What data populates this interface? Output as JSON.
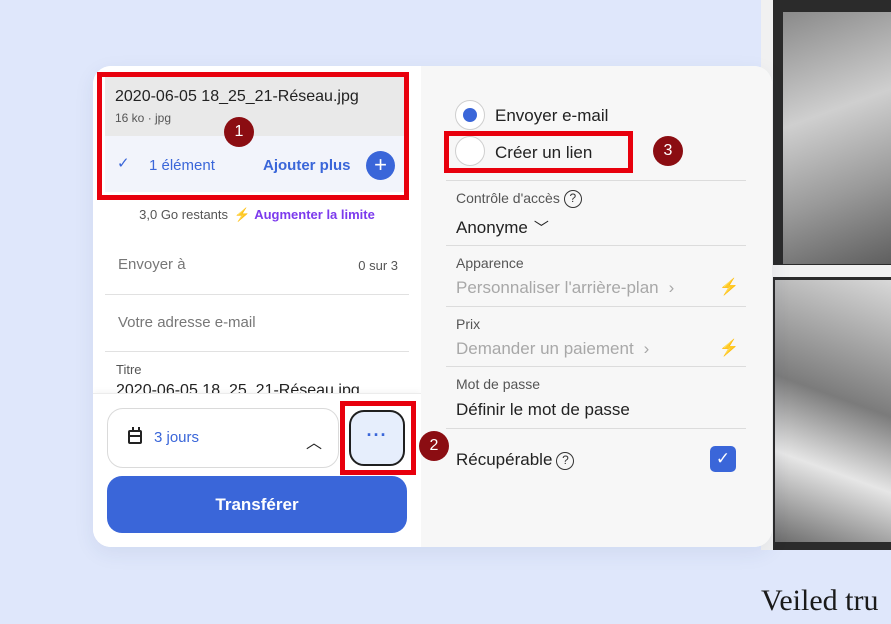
{
  "background_text": "Veiled tru",
  "file": {
    "name": "2020-06-05 18_25_21-Réseau.jpg",
    "meta": "16 ko · jpg",
    "count_label": "1 élément",
    "add_more": "Ajouter plus"
  },
  "storage": {
    "remaining": "3,0 Go restants",
    "upgrade": "Augmenter la limite"
  },
  "form": {
    "send_to_label": "Envoyer à",
    "send_to_counter": "0 sur 3",
    "email_placeholder": "Votre adresse e-mail",
    "title_label": "Titre",
    "title_value": "2020-06-05 18_25_21-Réseau.jpg"
  },
  "bottom": {
    "expiry": "3 jours",
    "more": "···",
    "transfer": "Transférer"
  },
  "options": {
    "mode_email": "Envoyer e-mail",
    "mode_link": "Créer un lien",
    "access_label": "Contrôle d'accès",
    "access_value": "Anonyme",
    "appearance_label": "Apparence",
    "appearance_value": "Personnaliser l'arrière-plan",
    "price_label": "Prix",
    "price_value": "Demander un paiement",
    "password_label": "Mot de passe",
    "password_value": "Définir le mot de passe",
    "recoverable_label": "Récupérable",
    "recoverable_checked": true
  },
  "annotations": [
    "1",
    "2",
    "3"
  ],
  "colors": {
    "accent": "#3a66d9",
    "upgrade": "#7c3aed",
    "highlight": "#e8000d",
    "badge": "#8b0d12"
  }
}
